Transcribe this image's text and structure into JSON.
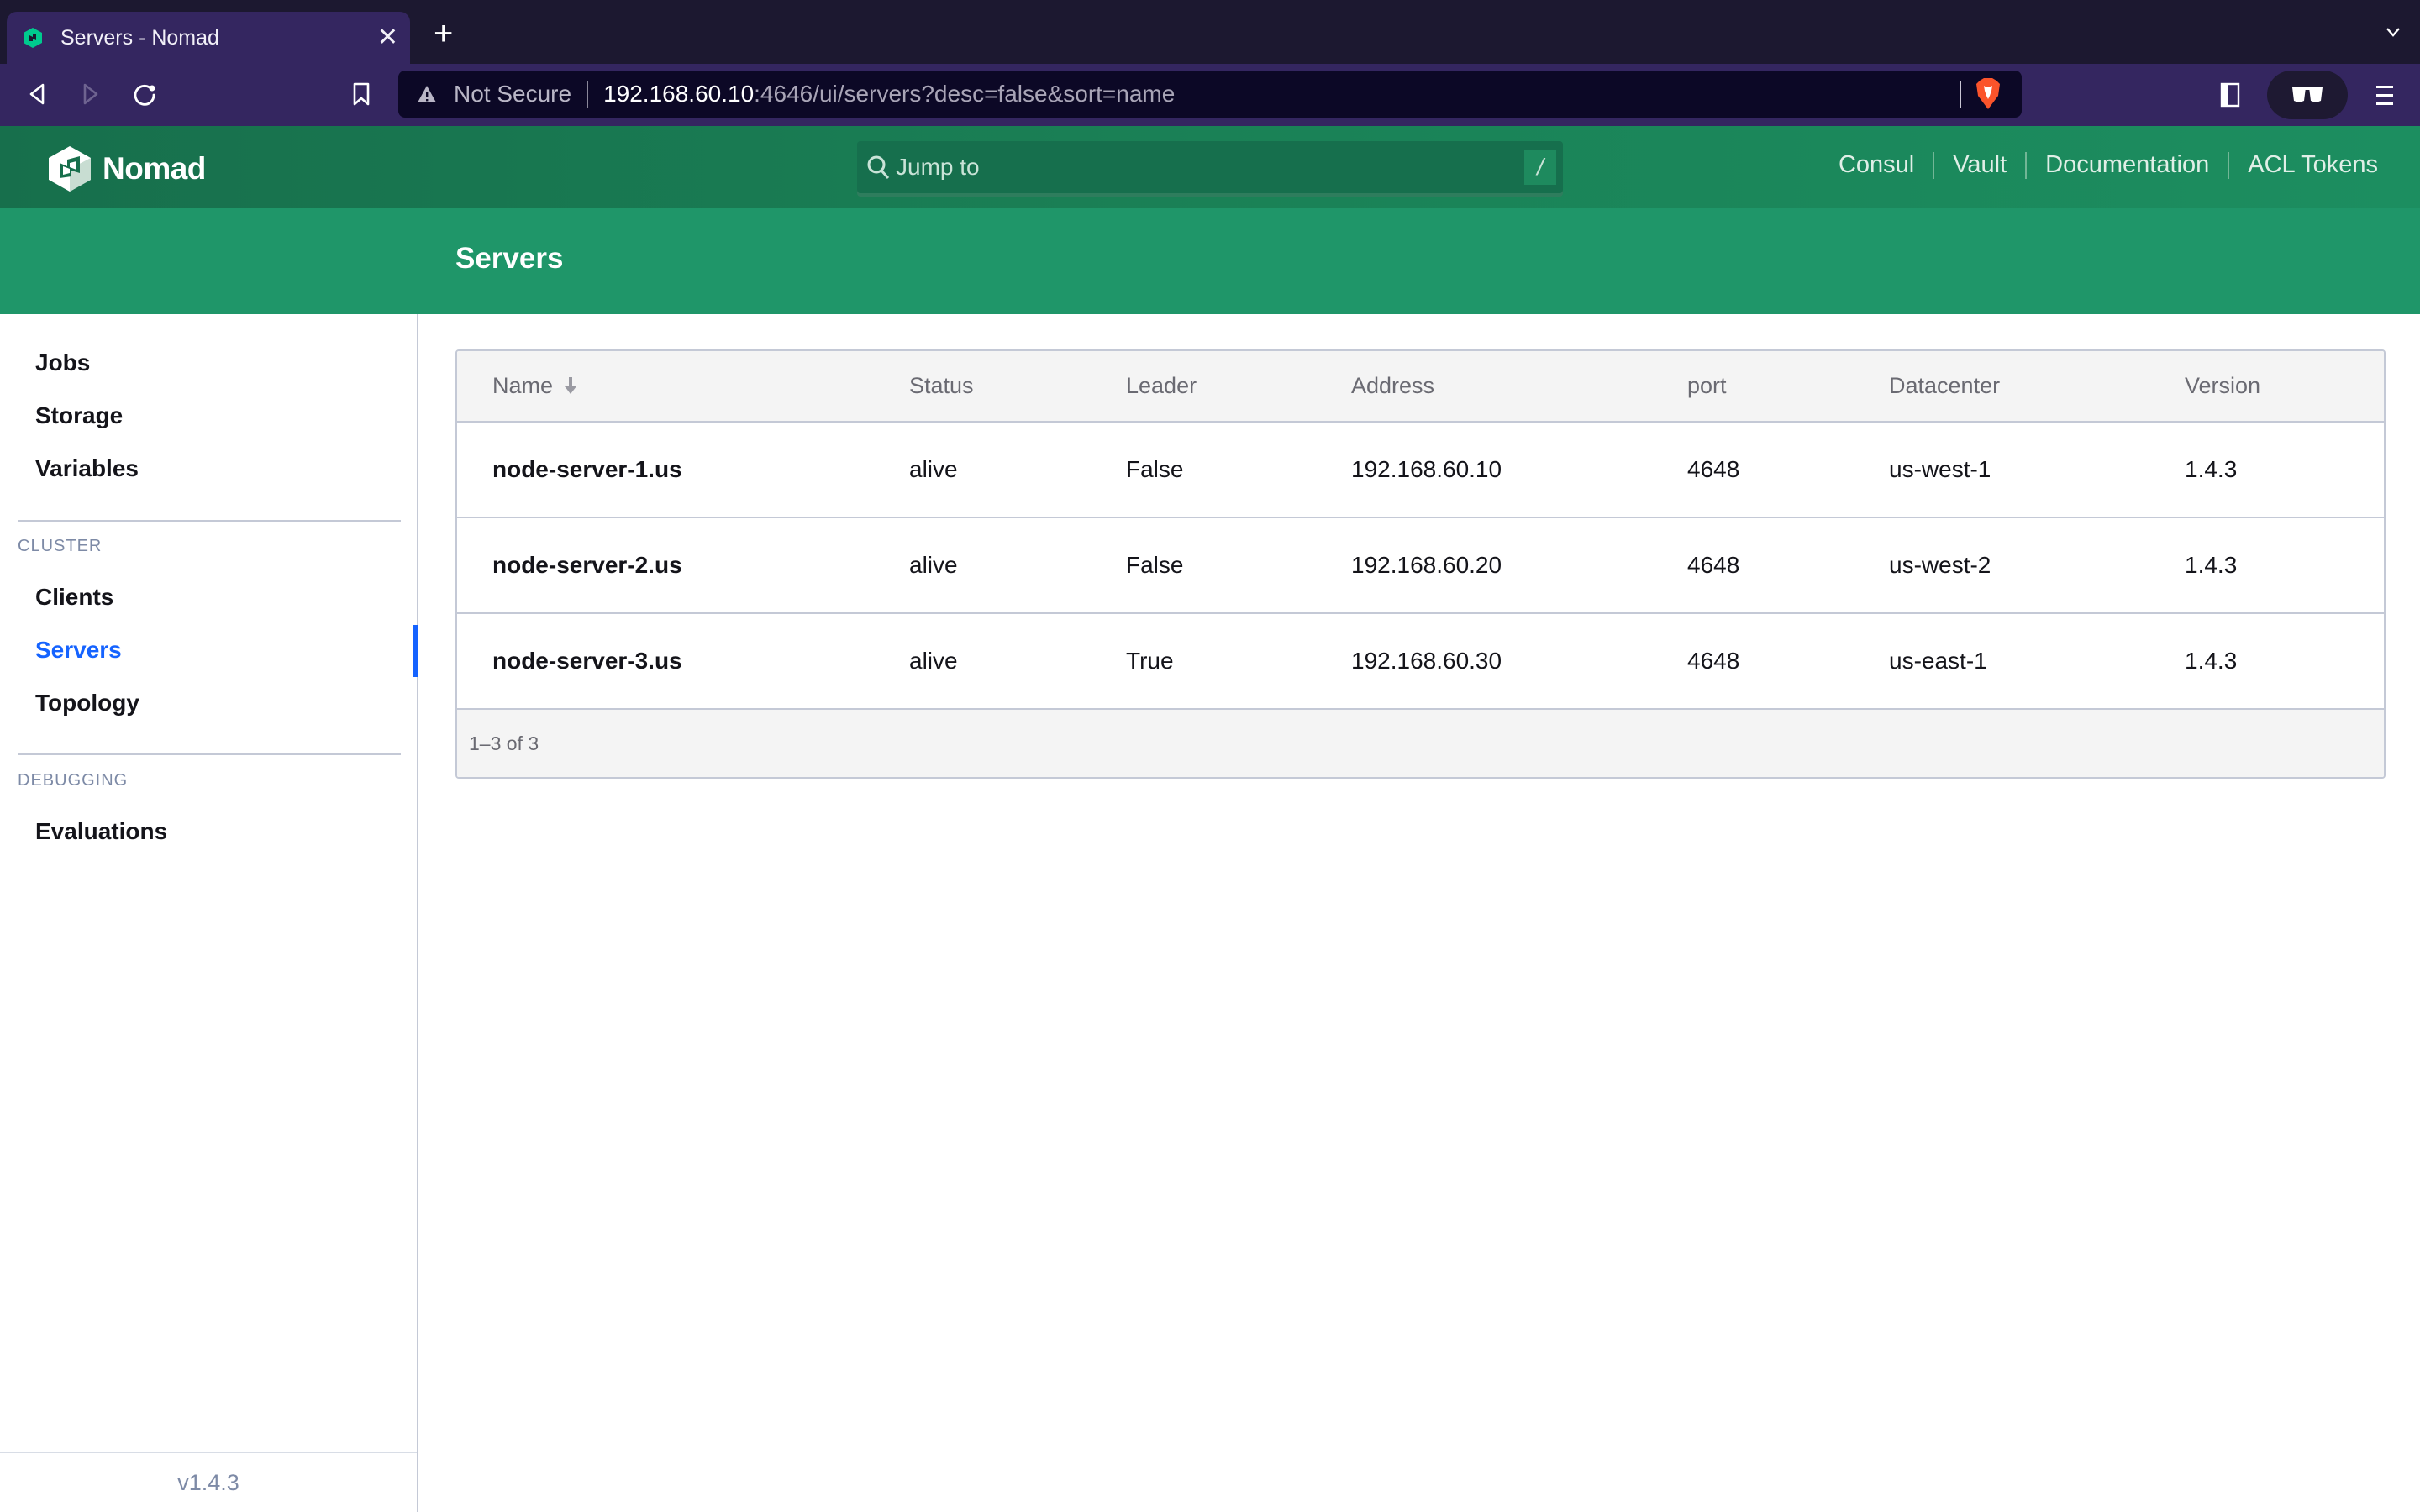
{
  "browser": {
    "tab_title": "Servers - Nomad",
    "new_tab_label": "+",
    "security_label": "Not Secure",
    "url_host": "192.168.60.10",
    "url_rest": ":4646/ui/servers?desc=false&sort=name"
  },
  "header": {
    "app_name": "Nomad",
    "search_placeholder": "Jump to",
    "search_shortcut": "/",
    "links": [
      "Consul",
      "Vault",
      "Documentation",
      "ACL Tokens"
    ]
  },
  "page": {
    "title": "Servers"
  },
  "sidebar": {
    "items": [
      {
        "label": "Jobs"
      },
      {
        "label": "Storage"
      },
      {
        "label": "Variables"
      }
    ],
    "sections": [
      {
        "heading": "CLUSTER",
        "items": [
          {
            "label": "Clients"
          },
          {
            "label": "Servers",
            "active": true
          },
          {
            "label": "Topology"
          }
        ]
      },
      {
        "heading": "DEBUGGING",
        "items": [
          {
            "label": "Evaluations"
          }
        ]
      }
    ],
    "version": "v1.4.3",
    "accent_color": "#1563ff"
  },
  "table": {
    "columns": [
      "Name",
      "Status",
      "Leader",
      "Address",
      "port",
      "Datacenter",
      "Version"
    ],
    "sort_column": "Name",
    "sort_direction": "ascending",
    "rows": [
      [
        "node-server-1.us",
        "alive",
        "False",
        "192.168.60.10",
        "4648",
        "us-west-1",
        "1.4.3"
      ],
      [
        "node-server-2.us",
        "alive",
        "False",
        "192.168.60.20",
        "4648",
        "us-west-2",
        "1.4.3"
      ],
      [
        "node-server-3.us",
        "alive",
        "True",
        "192.168.60.30",
        "4648",
        "us-east-1",
        "1.4.3"
      ]
    ],
    "pagination": "1–3 of 3"
  },
  "colors": {
    "header_green": "#1a8156",
    "subheader_green": "#1f9669",
    "browser_chrome": "#342660"
  }
}
